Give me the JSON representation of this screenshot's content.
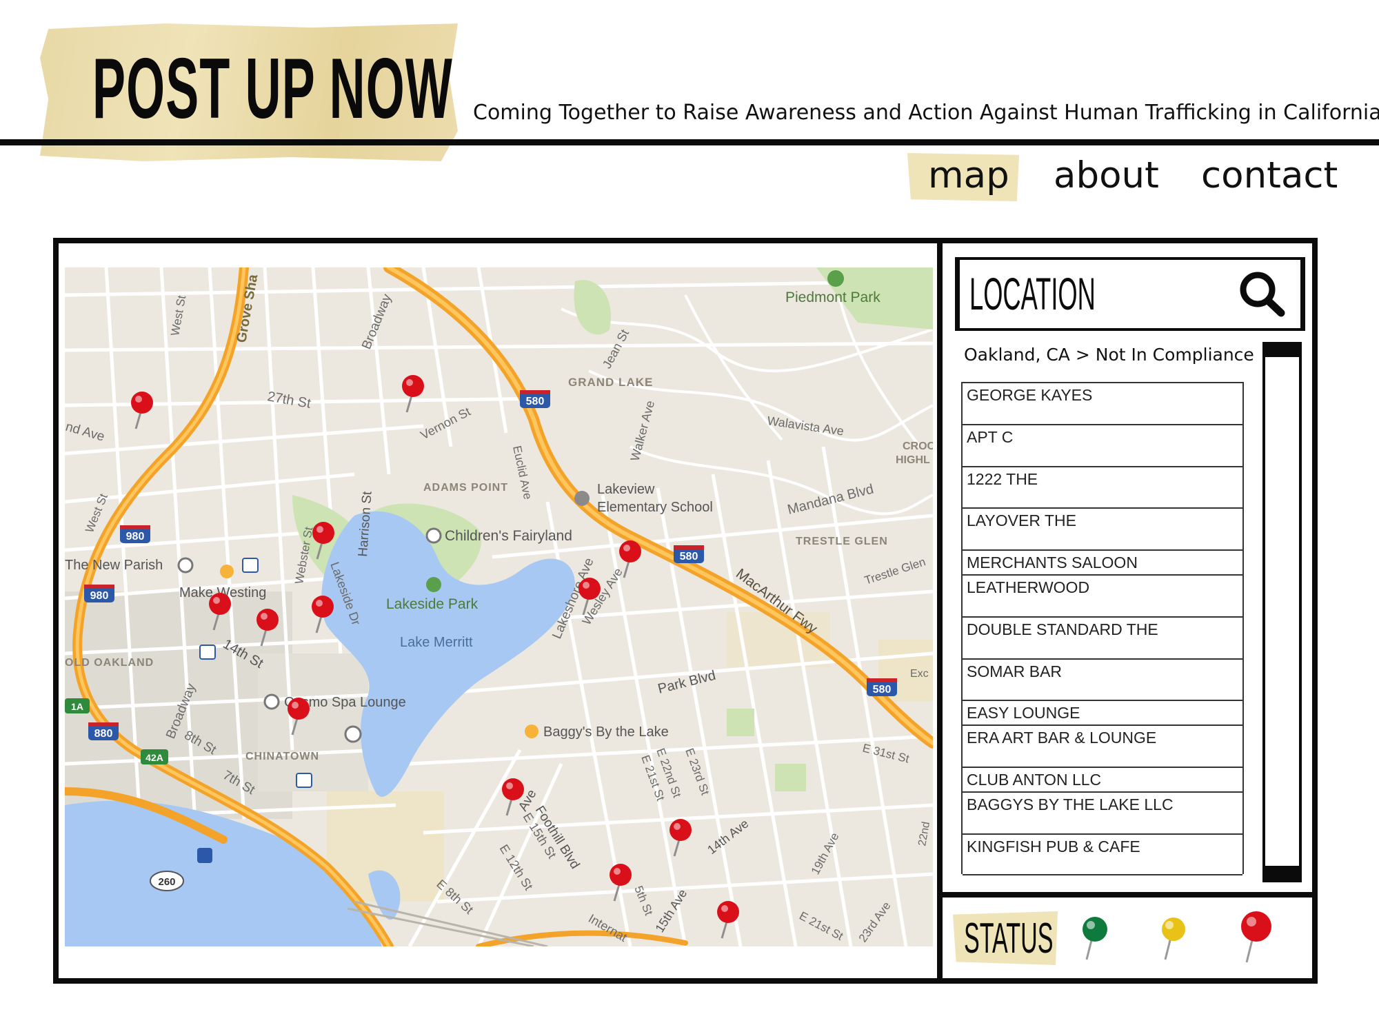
{
  "header": {
    "logo": "POST UP NOW",
    "tagline": "Coming Together to Raise Awareness and Action Against Human Trafficking in California"
  },
  "nav": {
    "map": "map",
    "about": "about",
    "contact": "contact",
    "active": "map"
  },
  "map": {
    "labels": {
      "piedmont_park": "Piedmont Park",
      "grand_lake": "GRAND LAKE",
      "jean_st": "Jean St",
      "walker_ave": "Walker Ave",
      "walavista": "Walavista Ave",
      "crocker": "CROC",
      "crocker2": "HIGHL",
      "mandana": "Mandana Blvd",
      "trestle_glen": "TRESTLE GLEN",
      "trestle_glen_rd": "Trestle Glen",
      "west_st": "West St",
      "grove_st": "Grove Sha",
      "broadway_top": "Broadway",
      "st_27th": "27th St",
      "vernon": "Vernon St",
      "adams_point": "ADAMS POINT",
      "euclid": "Euclid Ave",
      "lakeview": "Lakeview",
      "lakeview2": "Elementary School",
      "childrens_fairyland": "Children's Fairyland",
      "lakeside_park": "Lakeside Park",
      "lake_merritt": "Lake Merritt",
      "lakeshore": "Lakeshore Ave",
      "wesley": "Wesley Ave",
      "macarthur": "MacArthur Fwy",
      "grand_ave": "nd Ave",
      "west_st2": "West St",
      "new_parish": "The New Parish",
      "make_westing": "Make Westing",
      "webster": "Webster St",
      "harrison": "Harrison St",
      "lakeside_dr": "Lakeside Dr",
      "st_14th": "14th St",
      "old_oakland": "OLD OAKLAND",
      "broadway_low": "Broadway",
      "cosmo_spa": "Cosmo Spa Lounge",
      "st_8th": "8th St",
      "chinatown": "CHINATOWN",
      "st_7th": "7th St",
      "park_blvd": "Park Blvd",
      "baggys": "Baggy's By the Lake",
      "e22nd": "E 22nd St",
      "e21st": "E 21st St",
      "e23rd": "E 23rd St",
      "e31st": "E 31st St",
      "excel": "Exc",
      "ave1": "Ave",
      "foothill": "Foothill Blvd",
      "e15th": "E 15th St",
      "e12th": "E 12th St",
      "e8th": "E 8th St",
      "ave14th": "14th Ave",
      "ave19th": "19th Ave",
      "ave15th": "15th Ave",
      "internat": "Internat",
      "e21st2": "E 21st St",
      "ave23rd": "23rd Ave",
      "ave22nd": "22nd",
      "st_5th": "5th St"
    },
    "shields": {
      "i580a": "580",
      "i580b": "580",
      "i580c": "580",
      "i980a": "980",
      "i980b": "980",
      "i880": "880",
      "r260": "260",
      "r42a": "42A",
      "r1a": "1A"
    },
    "colors": {
      "land": "#ece8df",
      "park": "#cde3b3",
      "water": "#a6c8f2",
      "freeway": "#f3a32a",
      "street": "#ffffff",
      "pin": "#d9101a"
    }
  },
  "location_panel": {
    "search_label": "LOCATION",
    "search_icon": "magnifier",
    "breadcrumb": "Oakland, CA > Not In Compliance",
    "venues": [
      "GEORGE KAYES",
      "APT C",
      "1222 THE",
      "LAYOVER THE",
      "MERCHANTS SALOON",
      "LEATHERWOOD",
      "DOUBLE STANDARD THE",
      "SOMAR BAR",
      "EASY LOUNGE",
      "ERA ART BAR & LOUNGE",
      "CLUB ANTON LLC",
      "BAGGYS BY THE LAKE LLC",
      "KINGFISH PUB & CAFE"
    ]
  },
  "status": {
    "label": "STATUS",
    "legend": [
      {
        "name": "green",
        "color": "#0e7a3e"
      },
      {
        "name": "yellow",
        "color": "#e9c217"
      },
      {
        "name": "red",
        "color": "#d9101a"
      }
    ]
  }
}
